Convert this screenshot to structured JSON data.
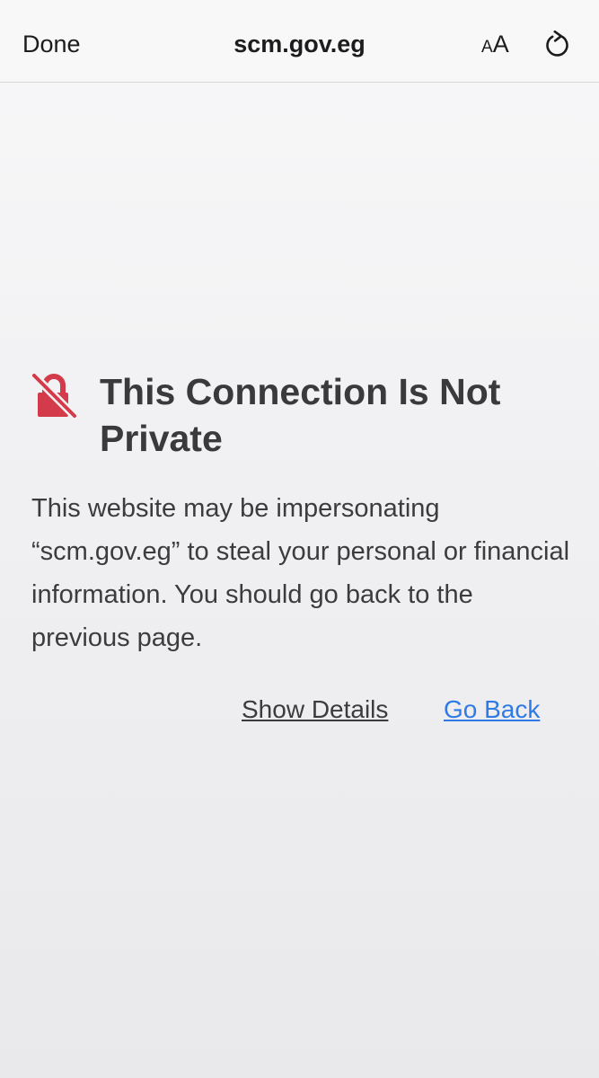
{
  "toolbar": {
    "done_label": "Done",
    "url": "scm.gov.eg",
    "text_size_label_small": "A",
    "text_size_label_large": "A",
    "reload_icon": "reload-icon"
  },
  "warning": {
    "icon": "lock-slash-icon",
    "title": "This Connection Is Not Private",
    "message": "This website may be impersonating “scm.gov.eg” to steal your personal or financial information. You should go back to the previous page.",
    "show_details_label": "Show Details",
    "go_back_label": "Go Back"
  },
  "colors": {
    "warning_icon": "#d33a4a",
    "link": "#2f7ae5"
  }
}
